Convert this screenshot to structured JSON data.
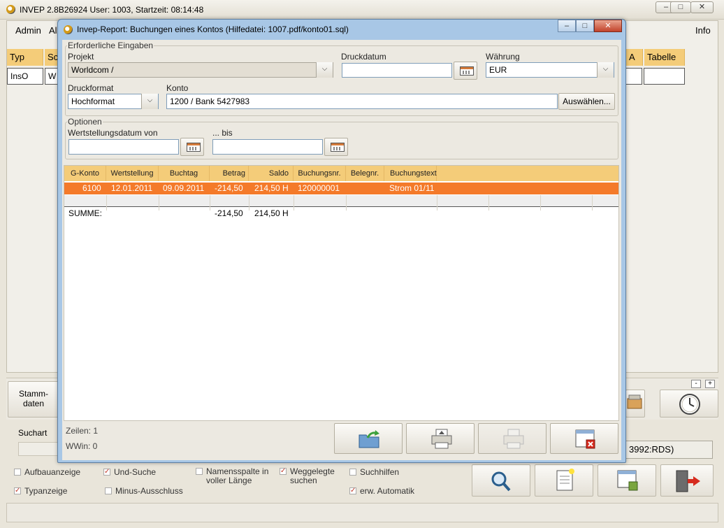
{
  "main_window": {
    "title": "INVEP 2.8B26924 User: 1003, Startzeit: 08:14:48",
    "controls": {
      "minimize": "–",
      "maximize": "□",
      "close": "✕"
    },
    "menu": {
      "admin": "Admin",
      "a": "Al",
      "info": "Info"
    },
    "columns": {
      "typ": "Typ",
      "s": "Sc",
      "a": "A",
      "tabelle": "Tabelle"
    },
    "filter_values": {
      "typ": "InsO",
      "s": "W"
    },
    "stamm_button": {
      "line1": "Stamm-",
      "line2": "daten"
    },
    "tiny_buttons": {
      "minus": "-",
      "plus": "+"
    },
    "suchart_label": "Suchart",
    "rds_text": "3992:RDS)",
    "checkboxes": [
      {
        "label": "Aufbauanzeige",
        "checked": false
      },
      {
        "label": "Und-Suche",
        "checked": true
      },
      {
        "label": "Namensspalte in voller Länge",
        "checked": false
      },
      {
        "label": "Weggelegte suchen",
        "checked": true
      },
      {
        "label": "Suchhilfen",
        "checked": false
      },
      {
        "label": "Typanzeige",
        "checked": true
      },
      {
        "label": "Minus-Ausschluss",
        "checked": false
      },
      {
        "label": "erw. Automatik",
        "checked": true
      }
    ],
    "check_mark": "✓"
  },
  "dialog": {
    "title": "Invep-Report: Buchungen eines Kontos   (Hilfedatei: 1007.pdf/konto01.sql)",
    "controls": {
      "minimize": "–",
      "maximize": "□",
      "close": "✕"
    },
    "required": {
      "legend": "Erforderliche Eingaben",
      "projekt_label": "Projekt",
      "projekt_value": "Worldcom /",
      "druckdatum_label": "Druckdatum",
      "druckdatum_value": "",
      "waehrung_label": "Währung",
      "waehrung_value": "EUR",
      "druckformat_label": "Druckformat",
      "druckformat_value": "Hochformat",
      "konto_label": "Konto",
      "konto_value": "1200 / Bank 5427983",
      "auswaehlen_label": "Auswählen..."
    },
    "options": {
      "legend": "Optionen",
      "von_label": "Wertstellungsdatum von",
      "von_value": "",
      "bis_label": "... bis",
      "bis_value": ""
    },
    "table": {
      "headers": [
        "G-Konto",
        "Wertstellung",
        "Buchtag",
        "Betrag",
        "Saldo",
        "Buchungsnr.",
        "Belegnr.",
        "Buchungstext"
      ],
      "rows": [
        {
          "gkonto": "6100",
          "wertstellung": "12.01.2011",
          "buchtag": "09.09.2011",
          "betrag": "-214,50",
          "saldo": "214,50 H",
          "buchungsnr": "120000001",
          "belegnr": "",
          "buchungstext": "Strom 01/11"
        }
      ],
      "summary": {
        "label": "SUMME:",
        "betrag": "-214,50",
        "saldo": "214,50 H"
      }
    },
    "footer": {
      "zeilen": "Zeilen: 1",
      "wwin": "WWin: 0"
    },
    "dropdown_arrow": "⌵"
  }
}
